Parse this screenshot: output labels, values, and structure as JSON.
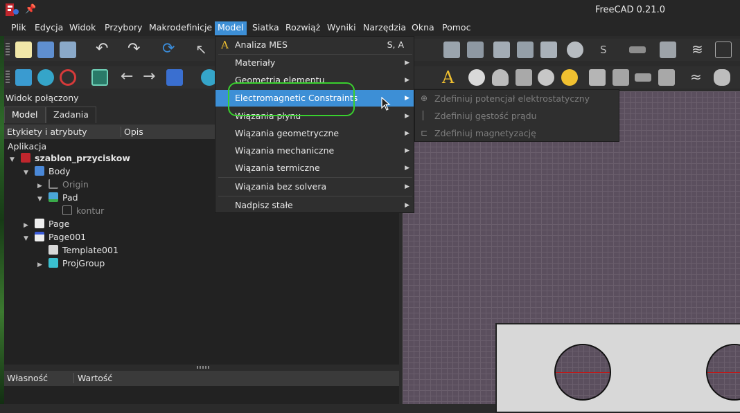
{
  "window": {
    "title": "FreeCAD 0.21.0"
  },
  "menubar": [
    "Plik",
    "Edycja",
    "Widok",
    "Przybory",
    "Makrodefinicje",
    "Model",
    "Siatka",
    "Rozwiąż",
    "Wyniki",
    "Narzędzia",
    "Okna",
    "Pomoc"
  ],
  "active_menu": "Model",
  "panel": {
    "title": "Widok połączony",
    "tabs": [
      "Model",
      "Zadania"
    ],
    "tree_headers": [
      "Etykiety i atrybuty",
      "Opis"
    ],
    "tree_root": "Aplikacja",
    "tree": [
      {
        "label": "szablon_przyciskow",
        "bold": true,
        "icon": "document-icon"
      },
      {
        "label": "Body",
        "icon": "body-icon"
      },
      {
        "label": "Origin",
        "icon": "origin-icon",
        "dim": true
      },
      {
        "label": "Pad",
        "icon": "pad-icon"
      },
      {
        "label": "kontur",
        "icon": "sketch-icon",
        "dim": true
      },
      {
        "label": "Page",
        "icon": "page-icon"
      },
      {
        "label": "Page001",
        "icon": "page-icon"
      },
      {
        "label": "Template001",
        "icon": "template-icon"
      },
      {
        "label": "ProjGroup",
        "icon": "projgroup-icon"
      }
    ],
    "prop_headers": [
      "Własność",
      "Wartość"
    ]
  },
  "model_menu": [
    {
      "label": "Analiza MES",
      "shortcut": "S, A",
      "icon": "analysis-icon"
    },
    {
      "label": "Materiały",
      "submenu": true
    },
    {
      "label": "Geometria elementu",
      "submenu": true
    },
    {
      "label": "Electromagnetic Constraints",
      "submenu": true,
      "highlighted": true
    },
    {
      "label": "Wiązania płynu",
      "submenu": true
    },
    {
      "label": "Wiązania geometryczne",
      "submenu": true
    },
    {
      "label": "Wiązania mechaniczne",
      "submenu": true
    },
    {
      "label": "Wiązania termiczne",
      "submenu": true
    },
    {
      "label": "Wiązania bez solvera",
      "submenu": true
    },
    {
      "label": "Nadpisz stałe",
      "submenu": true
    }
  ],
  "submenu": [
    {
      "label": "Zdefiniuj potencjał elektrostatyczny",
      "icon": "electrostatic-icon"
    },
    {
      "label": "Zdefiniuj gęstość prądu",
      "icon": "current-density-icon"
    },
    {
      "label": "Zdefiniuj magnetyzację",
      "icon": "magnetization-icon"
    }
  ],
  "colors": {
    "accent": "#3d8fd6",
    "highlight_ring": "#39d12e"
  }
}
